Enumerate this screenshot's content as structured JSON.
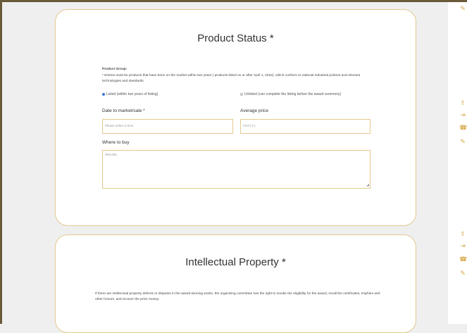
{
  "rail_icons": [
    "edit-icon",
    "share-icon",
    "login-icon",
    "phone-icon",
    "edit-icon"
  ],
  "product_status": {
    "title": "Product Status *",
    "group_label": "Product Group:",
    "group_note": "* Entries must be products that have been on the market within two years ( products listed on or after April 1, 2022), which conform to national industrial policies and relevant technologies and standards.",
    "radio_listed": "Listed (within two years of listing)",
    "radio_unlisted": "Unlisted (can complete the listing before the award ceremony)",
    "date_label": "Date to market/sale *",
    "date_placeholder": "Please select a time",
    "price_label": "Average price",
    "price_placeholder": "CNY( ¥ )",
    "where_label": "Where to buy",
    "where_placeholder": "describe"
  },
  "intellectual_property": {
    "title": "Intellectual Property *",
    "text": "If there are intellectual property defects or disputes in the award-winning works, the organizing committee has the right to revoke the eligibility for the award, recall the certificates, trophies and other honors, and recover the prize money."
  }
}
